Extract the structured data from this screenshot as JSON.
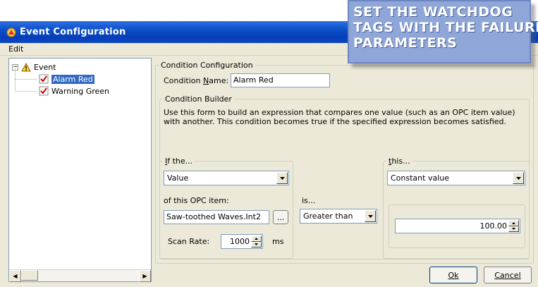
{
  "window": {
    "title": "Event Configuration"
  },
  "menu": {
    "edit": "Edit"
  },
  "tree": {
    "root_label": "Event",
    "items": [
      {
        "label": "Alarm Red",
        "selected": true
      },
      {
        "label": "Warning Green"
      }
    ]
  },
  "condition_config": {
    "legend": "Condition Configuration",
    "name_label": "Condition Name:",
    "name_value": "Alarm Red"
  },
  "builder": {
    "legend": "Condition Builder",
    "description": "Use this form to build an expression that compares one value (such as an OPC item value) with another.  This condition becomes true if the specified expression becomes satisfied.",
    "if_group": {
      "legend": "If the...",
      "source_value": "Value",
      "opc_label": "of this OPC item:",
      "opc_value": "Saw-toothed Waves.Int2",
      "browse_label": "...",
      "scan_label": "Scan Rate:",
      "scan_value": "1000",
      "scan_unit": "ms"
    },
    "is_label": "is...",
    "operator_value": "Greater than",
    "this_group": {
      "legend": "this...",
      "type_value": "Constant value",
      "constant_value": "100.00"
    }
  },
  "buttons": {
    "ok": "Ok",
    "cancel": "Cancel"
  },
  "callout": {
    "lines": [
      "SET THE WATCHDOG",
      "TAGS WITH THE FAILURE",
      "PARAMETERS"
    ]
  },
  "colors": {
    "titlebar": "#0a4fc9",
    "selection": "#316ac5",
    "callout_bg": "#8fa6d9"
  }
}
